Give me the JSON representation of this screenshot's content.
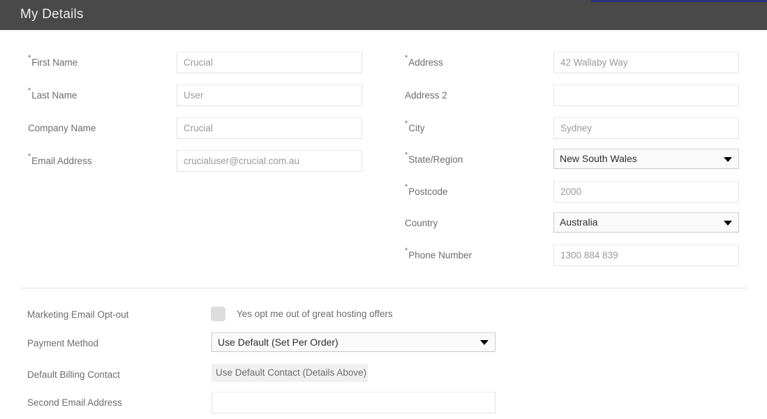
{
  "accent_color": "#2b2f7e",
  "header": {
    "title": "My Details",
    "bg_color": "#494949"
  },
  "left_column": {
    "fields": [
      {
        "label": "First Name",
        "required": true,
        "value": "Crucial",
        "type": "text"
      },
      {
        "label": "Last Name",
        "required": true,
        "value": "User",
        "type": "text"
      },
      {
        "label": "Company Name",
        "required": false,
        "value": "Crucial",
        "type": "text"
      },
      {
        "label": "Email Address",
        "required": true,
        "value": "crucialuser@crucial.com.au",
        "type": "text"
      }
    ]
  },
  "right_column": {
    "fields": [
      {
        "label": "Address",
        "required": true,
        "value": "42 Wallaby Way",
        "type": "text"
      },
      {
        "label": "Address 2",
        "required": false,
        "value": "",
        "type": "text"
      },
      {
        "label": "City",
        "required": true,
        "value": "Sydney",
        "type": "text"
      },
      {
        "label": "State/Region",
        "required": true,
        "value": "New South Wales",
        "type": "select"
      },
      {
        "label": "Postcode",
        "required": true,
        "value": "2000",
        "type": "text"
      },
      {
        "label": "Country",
        "required": false,
        "value": "Australia",
        "type": "select"
      },
      {
        "label": "Phone Number",
        "required": true,
        "value": "1300 884 839",
        "type": "text"
      }
    ]
  },
  "lower_section": {
    "marketing": {
      "label": "Marketing Email Opt-out",
      "checkbox_label": "Yes opt me out of great hosting offers",
      "checked": false
    },
    "payment_method": {
      "label": "Payment Method",
      "value": "Use Default (Set Per Order)"
    },
    "default_billing_contact": {
      "label": "Default Billing Contact",
      "value": "Use Default Contact (Details Above)"
    },
    "second_email": {
      "label": "Second Email Address",
      "value": ""
    }
  }
}
